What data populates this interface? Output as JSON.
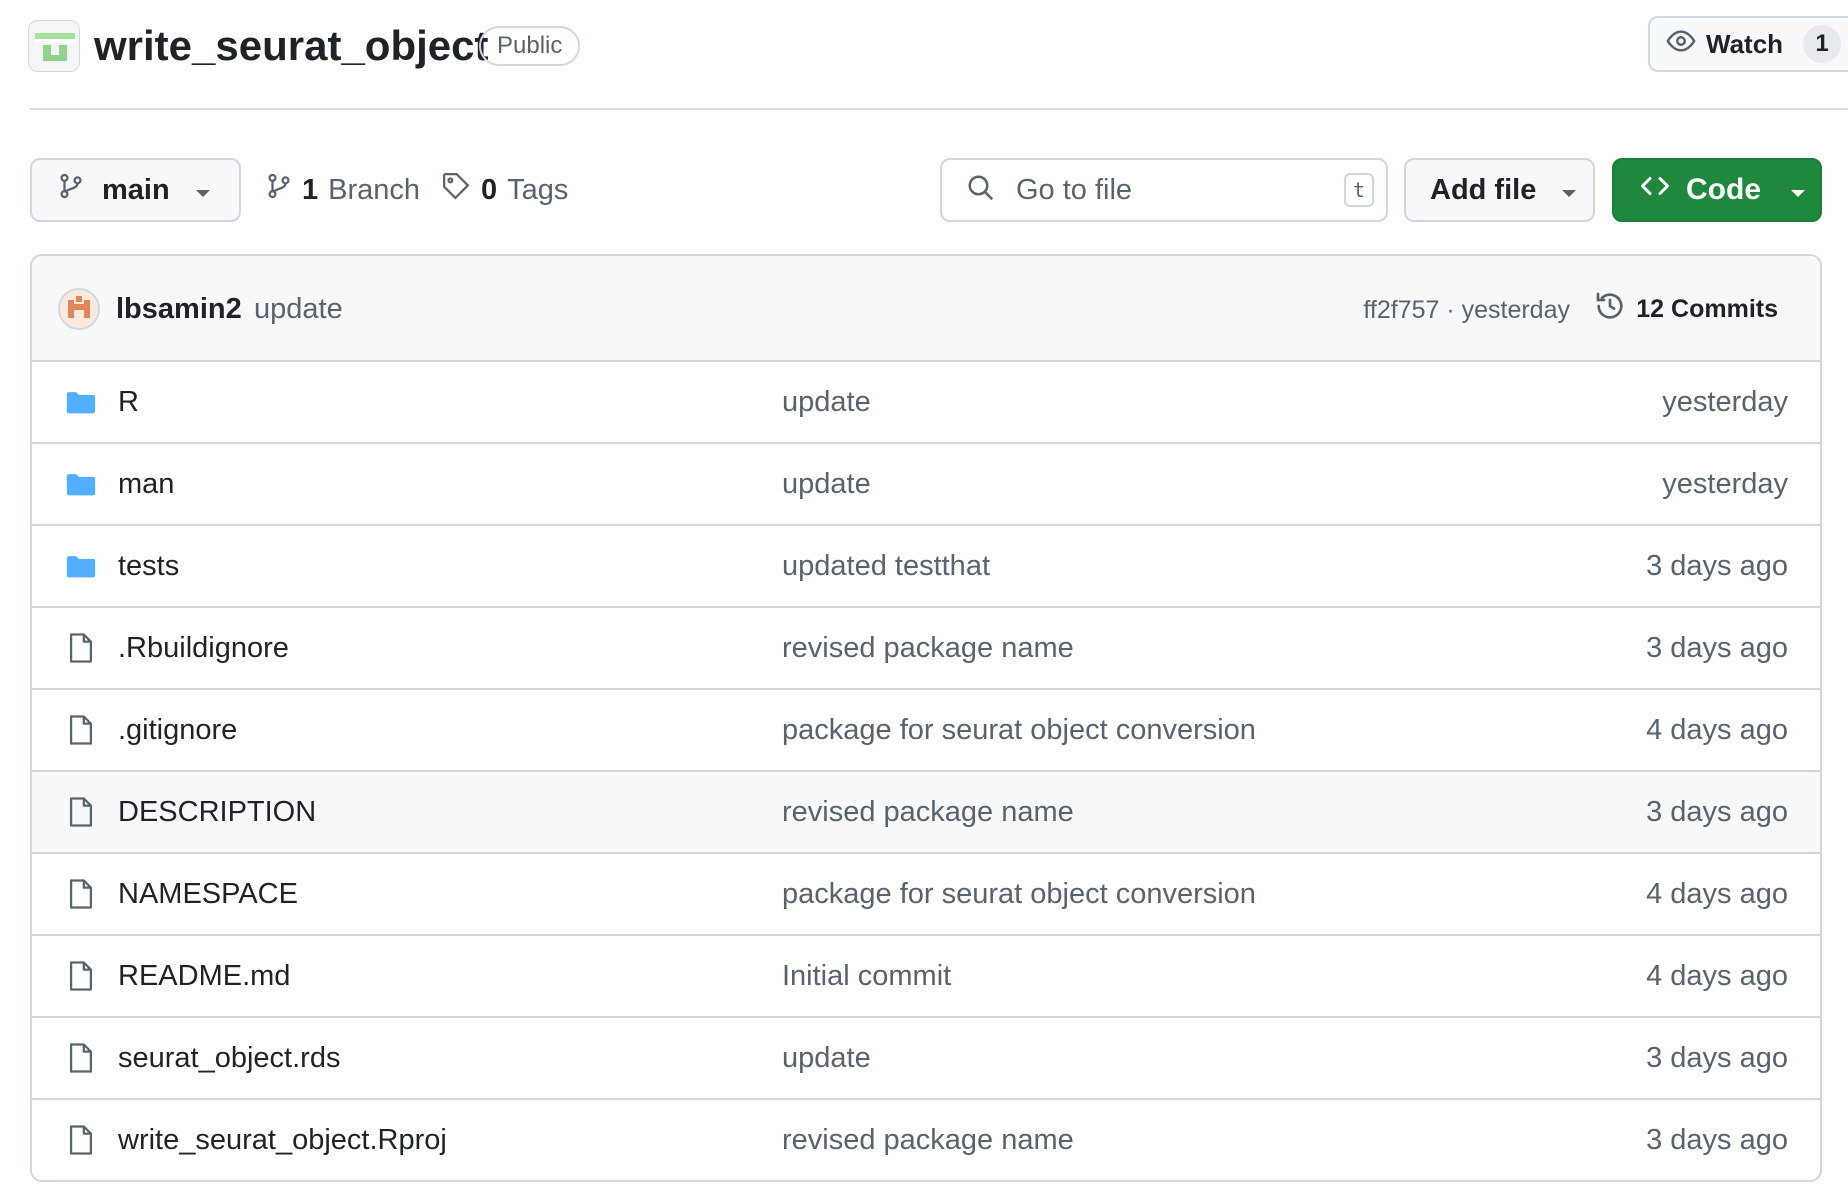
{
  "repo": {
    "name": "write_seurat_object",
    "visibility": "Public",
    "watch_label": "Watch",
    "watch_count": "1"
  },
  "toolbar": {
    "branch": "main",
    "branch_count": "1",
    "branch_label": "Branch",
    "tag_count": "0",
    "tag_label": "Tags",
    "search_placeholder": "Go to file",
    "search_shortcut": "t",
    "add_file_label": "Add file",
    "code_label": "Code"
  },
  "commit": {
    "author": "lbsamin2",
    "message": "update",
    "meta": "ff2f757 · yesterday",
    "commits_label": "12 Commits"
  },
  "files": [
    {
      "type": "folder",
      "name": "R",
      "message": "update",
      "date": "yesterday"
    },
    {
      "type": "folder",
      "name": "man",
      "message": "update",
      "date": "yesterday"
    },
    {
      "type": "folder",
      "name": "tests",
      "message": "updated testthat",
      "date": "3 days ago"
    },
    {
      "type": "file",
      "name": ".Rbuildignore",
      "message": "revised package name",
      "date": "3 days ago"
    },
    {
      "type": "file",
      "name": ".gitignore",
      "message": "package for seurat object conversion",
      "date": "4 days ago"
    },
    {
      "type": "file",
      "name": "DESCRIPTION",
      "message": "revised package name",
      "date": "3 days ago"
    },
    {
      "type": "file",
      "name": "NAMESPACE",
      "message": "package for seurat object conversion",
      "date": "4 days ago"
    },
    {
      "type": "file",
      "name": "README.md",
      "message": "Initial commit",
      "date": "4 days ago"
    },
    {
      "type": "file",
      "name": "seurat_object.rds",
      "message": "update",
      "date": "3 days ago"
    },
    {
      "type": "file",
      "name": "write_seurat_object.Rproj",
      "message": "revised package name",
      "date": "3 days ago"
    }
  ],
  "colors": {
    "accent_green": "#1f883d",
    "folder_blue": "#54aeff",
    "muted_text": "#59636e",
    "border": "#d0d7de"
  }
}
